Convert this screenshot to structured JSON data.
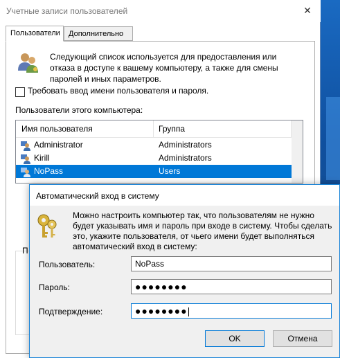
{
  "main_window": {
    "title": "Учетные записи пользователей",
    "close_glyph": "✕",
    "tabs": [
      {
        "label": "Пользователи",
        "active": true
      },
      {
        "label": "Дополнительно",
        "active": false
      }
    ],
    "description": "Следующий список используется для предоставления или отказа в доступе к вашему компьютеру, а также для смены паролей и иных параметров.",
    "require_login_checkbox": {
      "label": "Требовать ввод имени пользователя и пароля.",
      "checked": false
    },
    "users_group_label": "Пользователи этого компьютера:",
    "table": {
      "columns": [
        "Имя пользователя",
        "Группа"
      ],
      "rows": [
        {
          "name": "Administrator",
          "group": "Administrators",
          "selected": false
        },
        {
          "name": "Kirill",
          "group": "Administrators",
          "selected": false
        },
        {
          "name": "NoPass",
          "group": "Users",
          "selected": true
        }
      ]
    },
    "partial_label": "П"
  },
  "dialog": {
    "title": "Автоматический вход в систему",
    "description": "Можно настроить компьютер так, что пользователям не нужно будет указывать имя и пароль при входе в систему. Чтобы сделать это, укажите пользователя, от чьего имени будет выполняться автоматический вход в систему:",
    "fields": {
      "user": {
        "label": "Пользователь:",
        "value": "NoPass"
      },
      "password": {
        "label": "Пароль:",
        "value": "●●●●●●●●"
      },
      "confirm": {
        "label": "Подтверждение:",
        "value": "●●●●●●●●"
      }
    },
    "ok_label": "OK",
    "cancel_label": "Отмена"
  },
  "colors": {
    "selection": "#0078d7",
    "dialog_border": "#1883d7",
    "desktop": "#1d5fa8"
  },
  "icons": {
    "users": "users-icon",
    "user_row": "user-account-icon",
    "keys": "keys-icon",
    "close": "close-icon"
  }
}
